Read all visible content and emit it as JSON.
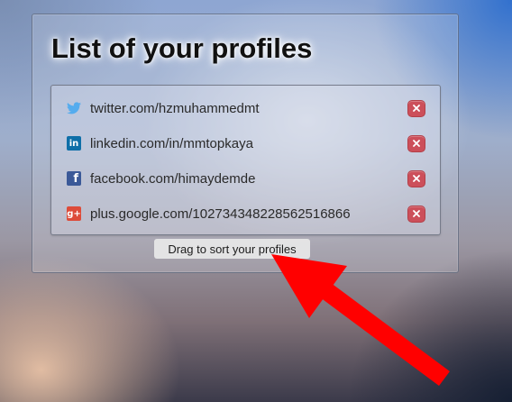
{
  "panel": {
    "title": "List of your profiles",
    "profiles": [
      {
        "network": "twitter",
        "icon": "twitter-icon",
        "url": "twitter.com/hzmuhammedmt",
        "remove_icon": "close-icon"
      },
      {
        "network": "linkedin",
        "icon": "linkedin-icon",
        "url": "linkedin.com/in/mmtopkaya",
        "remove_icon": "close-icon"
      },
      {
        "network": "facebook",
        "icon": "facebook-icon",
        "url": "facebook.com/himaydemde",
        "remove_icon": "close-icon"
      },
      {
        "network": "google-plus",
        "icon": "google-plus-icon",
        "url": "plus.google.com/102734348228562516866",
        "remove_icon": "close-icon"
      }
    ],
    "hint": "Drag to sort your profiles"
  },
  "icons": {
    "linkedin_glyph": "in",
    "facebook_glyph": "f",
    "google_glyph": "g+"
  },
  "colors": {
    "twitter": "#55acee",
    "linkedin": "#0e6fa8",
    "facebook": "#3b5998",
    "google": "#dd4b39",
    "remove": "#cc4f5a",
    "annotation_arrow": "#ff0000"
  }
}
